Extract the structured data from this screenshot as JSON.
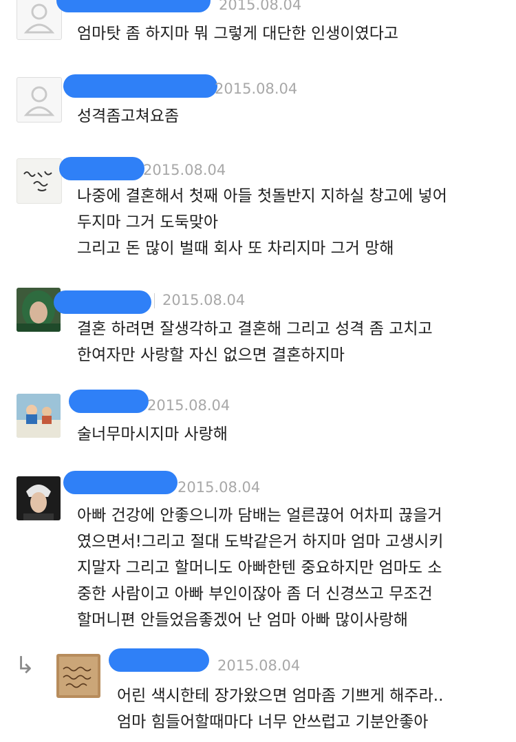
{
  "comments": [
    {
      "date": "2015.08.04",
      "text": "엄마탓 좀 하지마 뭐 그렇게 대단한 인생이였다고",
      "avatar": "default-user-icon"
    },
    {
      "date": "2015.08.04",
      "text": "성격좀고쳐요좀",
      "avatar": "default-user-icon"
    },
    {
      "date": "2015.08.04",
      "text": "나중에 결혼해서 첫째 아들 첫돌반지 지하실 창고에 넣어\n두지마 그거 도둑맞아\n그리고 돈 많이 벌때  회사 또 차리지마 그거 망해",
      "avatar": "handwriting-avatar",
      "avatar_text": "나의 아버지"
    },
    {
      "date": "2015.08.04",
      "text": "결혼 하려면 잘생각하고 결혼해 그리고 성격 좀 고치고\n한여자만 사랑할 자신 없으면 결혼하지마",
      "avatar": "green-hood-person-avatar"
    },
    {
      "date": "2015.08.04",
      "text": "술너무마시지마 사랑해",
      "avatar": "cartoon-avatar"
    },
    {
      "date": "2015.08.04",
      "text": "아빠 건강에 안좋으니까 담배는 얼른끊어 어차피 끊을거\n였으면서!그리고 절대 도박같은거 하지마 엄마 고생시키\n지말자 그리고 할머니도 아빠한텐 중요하지만 엄마도 소\n중한 사람이고 아빠 부인이잖아 좀 더 신경쓰고 무조건\n할머니편 안들었음좋겠어 난 엄마 아빠 많이사랑해",
      "avatar": "singer-photo-avatar"
    },
    {
      "date": "2015.08.04",
      "text": "어린 색시한테 장가왔으면 엄마좀 기쁘게 해주라..\n엄마 힘들어할때마다 너무 안쓰럽고 기분안좋아",
      "avatar": "handwriting-card-avatar",
      "avatar_text": "엄청 미안해 사랑해 엄마가",
      "reply_icon": "↳"
    }
  ],
  "colors": {
    "redaction": "#2f80f7",
    "date": "#a8a8a8",
    "text": "#1e1e1e",
    "divider": "#d9d9d9"
  }
}
